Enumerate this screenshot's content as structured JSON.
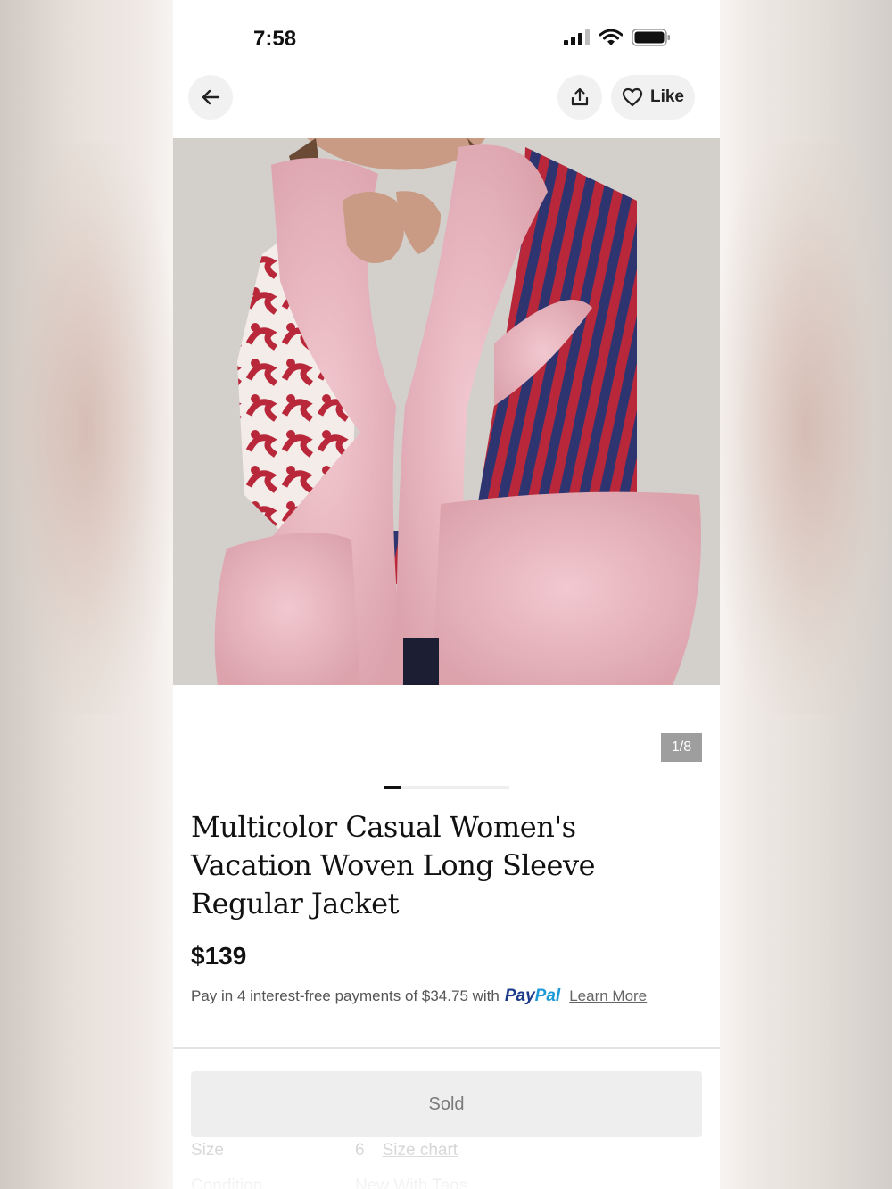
{
  "status_bar": {
    "time": "7:58"
  },
  "header": {
    "like_label": "Like"
  },
  "gallery": {
    "counter": "1/8",
    "current": 1,
    "total": 8
  },
  "product": {
    "title": "Multicolor Casual Women's Vacation Woven Long Sleeve Regular Jacket",
    "price": "$139",
    "payment_text": "Pay in 4 interest-free payments of $34.75 with",
    "paypal_pay": "Pay",
    "paypal_pal": "Pal",
    "learn_more": "Learn More"
  },
  "details": {
    "size_label": "Size",
    "size_value": "6",
    "size_chart": "Size chart",
    "condition_label": "Condition",
    "condition_value": "New With Tags"
  },
  "action": {
    "sold_label": "Sold"
  },
  "colors": {
    "paypal_dark": "#1b3a8a",
    "paypal_light": "#1e9ad6",
    "fur_pink": "#e9b8c0",
    "stripe_red": "#b8283a",
    "stripe_navy": "#2e3470"
  }
}
